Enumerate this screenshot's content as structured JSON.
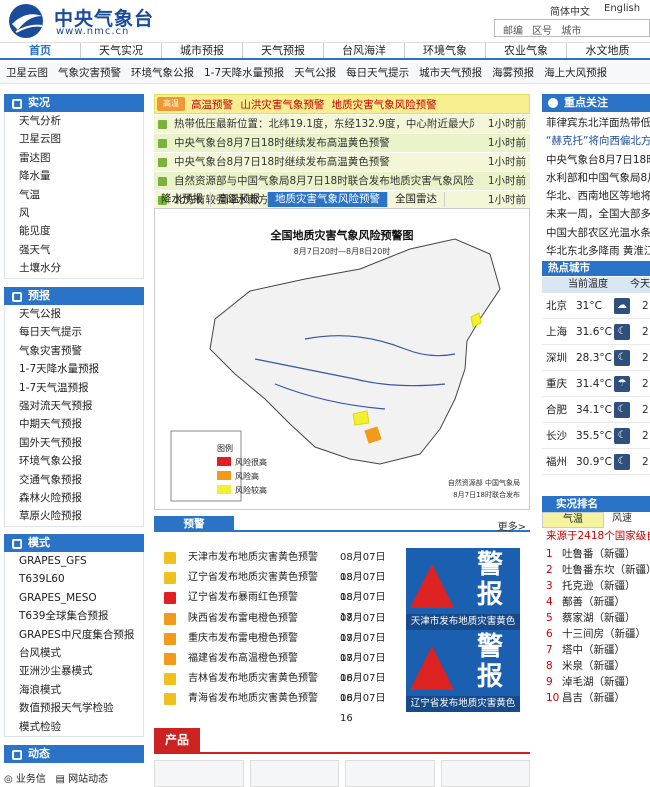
{
  "header": {
    "title": "中央气象台",
    "url": "www.nmc.cn",
    "lang_cn": "简体中文",
    "lang_en": "English",
    "search_placeholder": "邮编 区号 城市"
  },
  "nav": [
    "首页",
    "天气实况",
    "城市预报",
    "天气预报",
    "台风海洋",
    "环境气象",
    "农业气象",
    "水文地质"
  ],
  "subnav": [
    "卫星云图",
    "气象灾害预警",
    "环境气象公报",
    "1-7天降水量预报",
    "天气公报",
    "每日天气提示",
    "城市天气预报",
    "海雾预报",
    "海上大风预报"
  ],
  "side": {
    "s1": {
      "title": "实况",
      "items": [
        "天气分析",
        "卫星云图",
        "雷达图",
        "降水量",
        "气温",
        "风",
        "能见度",
        "强天气",
        "土壤水分"
      ]
    },
    "s2": {
      "title": "预报",
      "items": [
        "天气公报",
        "每日天气提示",
        "气象灾害预警",
        "1-7天降水量预报",
        "1-7天气温预报",
        "强对流天气预报",
        "中期天气预报",
        "国外天气预报",
        "环境气象公报",
        "交通气象预报",
        "森林火险预报",
        "草原火险预报"
      ]
    },
    "s3": {
      "title": "模式",
      "items": [
        "GRAPES_GFS",
        "T639L60",
        "GRAPES_MESO",
        "T639全球集合预报",
        "GRAPES中尺度集合预报",
        "台风模式",
        "亚洲沙尘暴模式",
        "海浪模式",
        "数值预报天气学检验",
        "模式检验"
      ]
    },
    "s4": {
      "title": "动态",
      "f1": "业务信",
      "f2": "网站动态"
    }
  },
  "alert": {
    "badge": "高温",
    "text": "高温预警  山洪灾害气象预警  地质灾害气象风险预警"
  },
  "news": [
    {
      "t": "热带低压最新位置：北纬19.1度，东经132.9度，中心附近最大风…",
      "tm": "1小时前"
    },
    {
      "t": "中央气象台8月7日18时继续发布高温黄色预警",
      "tm": "1小时前"
    },
    {
      "t": "中央气象台8月7日18时继续发布高温黄色预警",
      "tm": "1小时前"
    },
    {
      "t": "自然资源部与中国气象局8月7日18时联合发布地质灾害气象风险…",
      "tm": "1小时前"
    },
    {
      "t": "北方有较强降水南方地区高温发展",
      "tm": "1小时前"
    }
  ],
  "tabs": [
    "降水预报",
    "高温预报",
    "地质灾害气象风险预警",
    "全国雷达"
  ],
  "map": {
    "title": "全国地质灾害气象风险预警图",
    "sub": "8月7日20时—8月8日20时",
    "legend": "图例",
    "l1": "风险很高",
    "l2": "风险高",
    "l3": "风险较高",
    "credit1": "自然资源部  中国气象局",
    "credit2": "8月7日18时联合发布",
    "c_high": "#e02020",
    "c_mid": "#f39a1a",
    "c_low": "#f5ef33"
  },
  "warn": {
    "title": "预警",
    "more": "更多>"
  },
  "warnlist": [
    {
      "t": "天津市发布地质灾害黄色预警",
      "d": "08月07日18",
      "c": "#f0c020"
    },
    {
      "t": "辽宁省发布地质灾害黄色预警",
      "d": "08月07日18",
      "c": "#f0c020"
    },
    {
      "t": "辽宁省发布暴雨红色预警",
      "d": "08月07日17",
      "c": "#e02020"
    },
    {
      "t": "陕西省发布雷电橙色预警",
      "d": "08月07日17",
      "c": "#f39a1a"
    },
    {
      "t": "重庆市发布雷电橙色预警",
      "d": "08月07日17",
      "c": "#f39a1a"
    },
    {
      "t": "福建省发布高温橙色预警",
      "d": "08月07日16",
      "c": "#f39a1a"
    },
    {
      "t": "吉林省发布地质灾害黄色预警",
      "d": "08月07日16",
      "c": "#f0c020"
    },
    {
      "t": "青海省发布地质灾害黄色预警",
      "d": "08月07日16",
      "c": "#f0c020"
    }
  ],
  "cards": [
    {
      "big": "警报",
      "cap": "天津市发布地质灾害黄色"
    },
    {
      "big": "警报",
      "cap": "辽宁省发布地质灾害黄色"
    }
  ],
  "product": {
    "title": "产品"
  },
  "focus": {
    "title": "重点关注",
    "items": [
      "菲律宾东北洋面热带低压",
      "“赫克托”将向西偏北方向",
      "中央气象台8月7日18时",
      "水利部和中国气象局8月7日",
      "华北、西南地区等地将有",
      "未来一周，全国大部多",
      "中国大部农区光温水条件",
      "华北东北多降雨 黄淮江"
    ]
  },
  "hotcity": {
    "title": "热点城市",
    "col1": "当前温度",
    "col2": "今天",
    "rows": [
      {
        "n": "北京",
        "t": "31°C",
        "w": "☁",
        "t2": "2"
      },
      {
        "n": "上海",
        "t": "31.6°C",
        "w": "☾",
        "t2": "2"
      },
      {
        "n": "深圳",
        "t": "28.3°C",
        "w": "☾",
        "t2": "2"
      },
      {
        "n": "重庆",
        "t": "31.4°C",
        "w": "☂",
        "t2": "2"
      },
      {
        "n": "合肥",
        "t": "34.1°C",
        "w": "☾",
        "t2": "2"
      },
      {
        "n": "长沙",
        "t": "35.5°C",
        "w": "☾",
        "t2": "2"
      },
      {
        "n": "福州",
        "t": "30.9°C",
        "w": "☾",
        "t2": "2"
      }
    ]
  },
  "rank": {
    "title": "实况排名",
    "tab1": "气温",
    "tab2": "风速",
    "src": "来源于2418个国家级自",
    "items": [
      "吐鲁番（新疆）",
      "吐鲁番东坎（新疆）",
      "托克逊（新疆）",
      "鄯善（新疆）",
      "蔡家湖（新疆）",
      "十三间房（新疆）",
      "塔中（新疆）",
      "米泉（新疆）",
      "淖毛湖（新疆）",
      "昌吉（新疆）"
    ]
  }
}
